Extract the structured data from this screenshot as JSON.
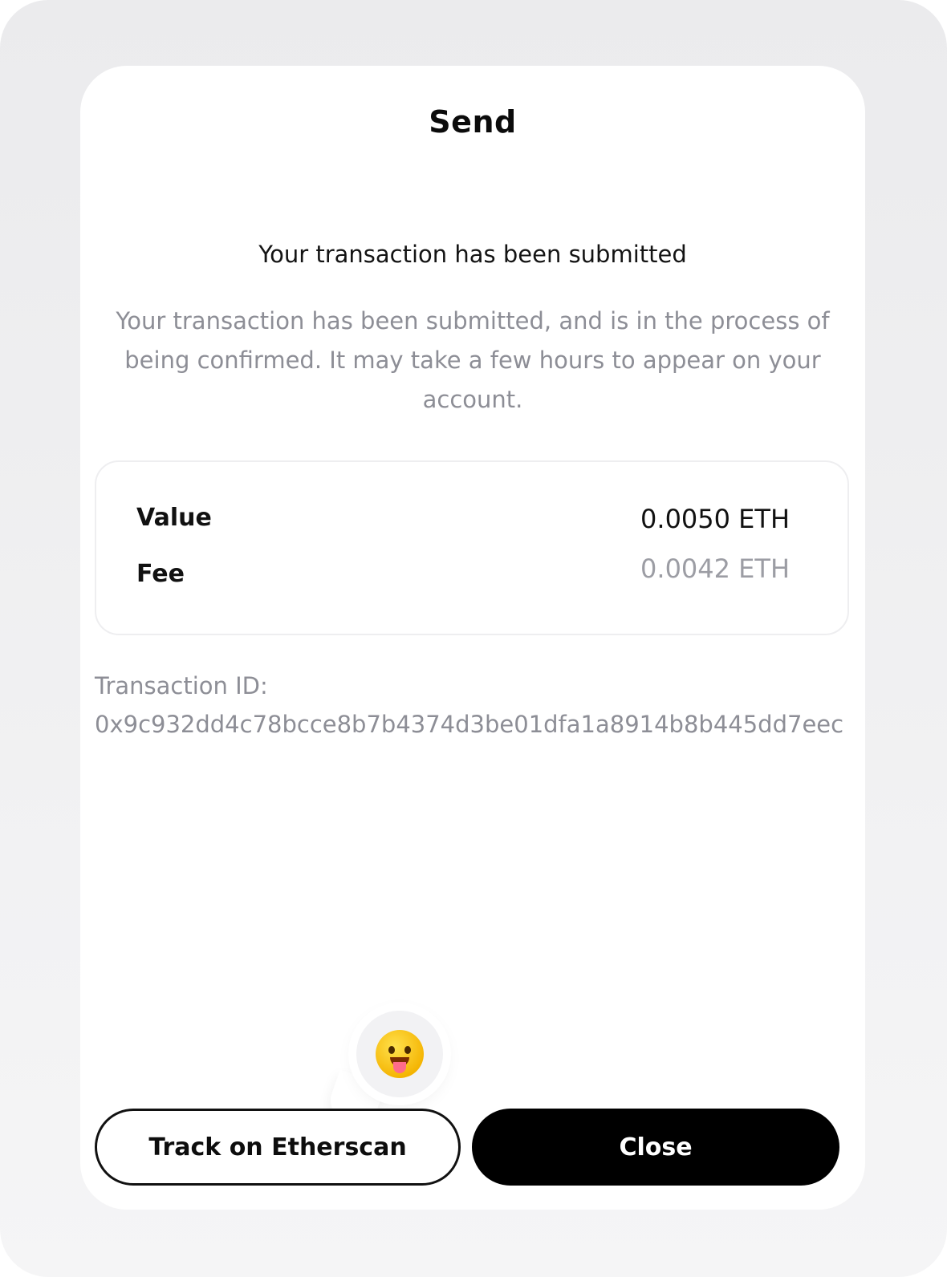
{
  "modal": {
    "title": "Send",
    "heading": "Your transaction has been submitted",
    "message": "Your transaction has been submitted, and is in the process of being confirmed. It may take a few hours to appear on your account."
  },
  "summary": {
    "value_label": "Value",
    "value_amount": "0.0050 ETH",
    "fee_label": "Fee",
    "fee_amount": "0.0042 ETH"
  },
  "transaction": {
    "id_label": "Transaction ID:",
    "id_value": "0x9c932dd4c78bcce8b7b4374d3be01dfa1a8914b8b445dd7eec"
  },
  "buttons": {
    "track_label": "Track on Etherscan",
    "close_label": "Close"
  },
  "icons": {
    "emoji": "tongue-out-emoji-icon"
  }
}
